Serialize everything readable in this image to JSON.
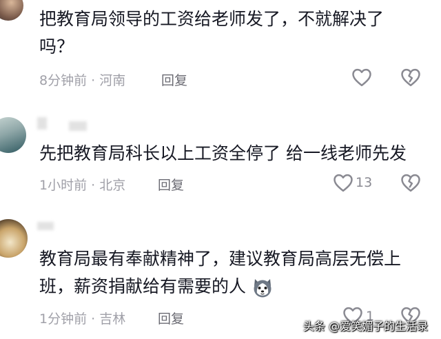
{
  "comments": [
    {
      "text_lines": [
        "把教育局领导的工资给老师发了，不就解决了",
        "吗？"
      ],
      "time": "8分钟前",
      "location": "河南",
      "reply_label": "回复"
    },
    {
      "text_lines": [
        "先把教育局科长以上工资全停了 给一线老师先发"
      ],
      "time": "1小时前",
      "location": "北京",
      "reply_label": "回复",
      "like_count": "13"
    },
    {
      "text_lines": [
        "教育局最有奉献精神了，建议教育局高层无偿上",
        "班，薪资捐献给有需要的人"
      ],
      "time": "1分钟前",
      "location": "吉林",
      "reply_label": "回复",
      "like_count": "1"
    }
  ],
  "meta_separator": " · ",
  "watermark": "头条 @爱笑媚子的生活录",
  "icons": {
    "like": "heart-outline-icon",
    "dislike": "broken-heart-icon",
    "emoji": "husky-emoji-icon"
  },
  "colors": {
    "text": "#161823",
    "meta": "#a0a0a8",
    "icon": "#8a8a92"
  }
}
